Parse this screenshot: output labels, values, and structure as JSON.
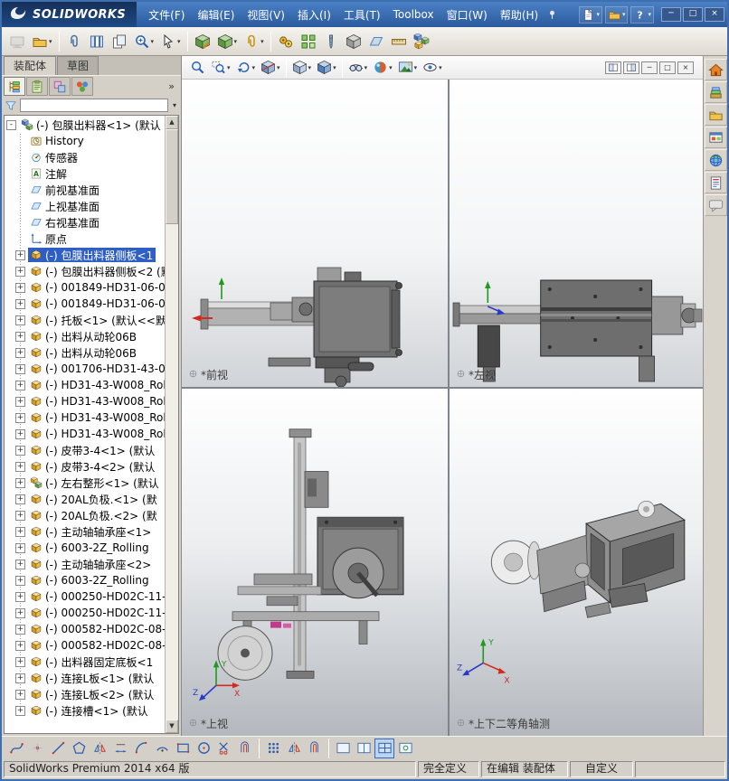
{
  "titlebar": {
    "brand": "SOLIDWORKS",
    "menus": [
      {
        "id": "file",
        "label": "文件(F)"
      },
      {
        "id": "edit",
        "label": "编辑(E)"
      },
      {
        "id": "view",
        "label": "视图(V)"
      },
      {
        "id": "insert",
        "label": "插入(I)"
      },
      {
        "id": "tools",
        "label": "工具(T)"
      },
      {
        "id": "toolbox",
        "label": "Toolbox"
      },
      {
        "id": "window",
        "label": "窗口(W)"
      },
      {
        "id": "help",
        "label": "帮助(H)"
      }
    ],
    "pin_icon": "pin",
    "quick_tools": [
      {
        "name": "new-document",
        "icon": "page",
        "caret": true
      },
      {
        "name": "open-document",
        "icon": "folder",
        "caret": true
      },
      {
        "name": "help",
        "icon": "help",
        "caret": true
      }
    ],
    "window_buttons": [
      {
        "name": "minimize-button",
        "glyph": "─"
      },
      {
        "name": "maximize-button",
        "glyph": "□"
      },
      {
        "name": "close-button",
        "glyph": "×"
      }
    ]
  },
  "main_toolbar": [
    {
      "name": "screen-capture",
      "icon": "screen-gray",
      "disabled": true
    },
    {
      "name": "appearance-folder",
      "icon": "folder",
      "caret": true
    },
    {
      "sep": true
    },
    {
      "name": "attachments",
      "icon": "paperclip"
    },
    {
      "name": "component-columns",
      "icon": "columns"
    },
    {
      "name": "compare-documents",
      "icon": "pages"
    },
    {
      "name": "zoom-tools",
      "icon": "magnifier-plus",
      "caret": true
    },
    {
      "name": "select-tools",
      "icon": "cursor",
      "caret": true
    },
    {
      "sep": true
    },
    {
      "name": "edit-component",
      "icon": "cube-green-pencil"
    },
    {
      "name": "insert-components",
      "icon": "cube-green",
      "caret": true
    },
    {
      "name": "mate",
      "icon": "mate",
      "caret": true
    },
    {
      "sep": true
    },
    {
      "name": "move-component",
      "icon": "gears"
    },
    {
      "name": "linear-component-pattern",
      "icon": "grid-green"
    },
    {
      "name": "smart-fasteners",
      "icon": "fastener"
    },
    {
      "name": "assembly-features",
      "icon": "cube-gray"
    },
    {
      "name": "reference-geometry",
      "icon": "plane"
    },
    {
      "name": "measure",
      "icon": "ruler"
    },
    {
      "name": "exploded-view",
      "icon": "explode"
    }
  ],
  "view_toolbar": [
    {
      "name": "zoom-to-fit",
      "icon": "magnifier"
    },
    {
      "name": "zoom-to-area",
      "icon": "magnifier-rect",
      "caret": true
    },
    {
      "name": "previous-view",
      "icon": "view-prev",
      "caret": true
    },
    {
      "name": "section-view",
      "icon": "section-cube",
      "caret": true
    },
    {
      "sep": true
    },
    {
      "name": "view-orientation",
      "icon": "orient-cube",
      "caret": true
    },
    {
      "name": "display-style",
      "icon": "shaded-cube",
      "caret": true
    },
    {
      "sep": true
    },
    {
      "name": "hide-show-items",
      "icon": "glasses",
      "caret": true
    },
    {
      "name": "edit-appearance",
      "icon": "ball",
      "caret": true
    },
    {
      "name": "apply-scene",
      "icon": "scene",
      "caret": true
    },
    {
      "name": "view-settings",
      "icon": "eye",
      "caret": true
    }
  ],
  "doc_window_buttons": [
    {
      "name": "doc-split-left-button",
      "icon": "win-a"
    },
    {
      "name": "doc-split-right-button",
      "icon": "win-b"
    },
    {
      "name": "doc-minimize-button",
      "glyph": "─"
    },
    {
      "name": "doc-restore-button",
      "glyph": "□"
    },
    {
      "name": "doc-close-button",
      "glyph": "×"
    }
  ],
  "task_pane": [
    {
      "name": "solidworks-resources",
      "icon": "house"
    },
    {
      "name": "design-library",
      "icon": "stack"
    },
    {
      "name": "file-explorer",
      "icon": "folder"
    },
    {
      "name": "view-palette",
      "icon": "palette-window"
    },
    {
      "name": "appearances-scenes",
      "icon": "globe"
    },
    {
      "name": "custom-properties",
      "icon": "form"
    },
    {
      "name": "forum",
      "icon": "chat"
    }
  ],
  "left_panel": {
    "doc_tabs": [
      {
        "id": "assembly",
        "label": "装配体",
        "active": true
      },
      {
        "id": "sketch",
        "label": "草图",
        "active": false
      }
    ],
    "manager_tabs": [
      {
        "name": "featuremanager-tab",
        "icon": "fm-tree",
        "active": true
      },
      {
        "name": "propertymanager-tab",
        "icon": "clipboard",
        "active": false
      },
      {
        "name": "configurationmanager-tab",
        "icon": "config",
        "active": false
      },
      {
        "name": "displaymanager-tab",
        "icon": "balls",
        "active": false
      }
    ],
    "overflow_chevron": "»",
    "filter": {
      "placeholder": ""
    },
    "tree": [
      {
        "icon": "assembly",
        "label": "(-) 包膜出料器<1> (默认",
        "level": 0,
        "expander": "minus"
      },
      {
        "icon": "history",
        "label": "History",
        "level": 1
      },
      {
        "icon": "sensor",
        "label": "传感器",
        "level": 1
      },
      {
        "icon": "annotation",
        "label": "注解",
        "level": 1
      },
      {
        "icon": "plane",
        "label": "前视基准面",
        "level": 1
      },
      {
        "icon": "plane",
        "label": "上视基准面",
        "level": 1
      },
      {
        "icon": "plane",
        "label": "右视基准面",
        "level": 1
      },
      {
        "icon": "origin",
        "label": "原点",
        "level": 1
      },
      {
        "icon": "component",
        "label": "(-) 包膜出料器侧板<1",
        "level": 1,
        "expander": "plus",
        "selected": true
      },
      {
        "icon": "component",
        "label": "(-) 包膜出料器侧板<2 (默",
        "level": 1,
        "expander": "plus"
      },
      {
        "icon": "component",
        "label": "(-) 001849-HD31-06-0",
        "level": 1,
        "expander": "plus"
      },
      {
        "icon": "component",
        "label": "(-) 001849-HD31-06-0",
        "level": 1,
        "expander": "plus"
      },
      {
        "icon": "component",
        "label": "(-) 托板<1> (默认<<默",
        "level": 1,
        "expander": "plus"
      },
      {
        "icon": "component",
        "label": "(-) 出料从动轮06B",
        "level": 1,
        "expander": "plus"
      },
      {
        "icon": "component",
        "label": "(-) 出料从动轮06B",
        "level": 1,
        "expander": "plus"
      },
      {
        "icon": "component",
        "label": "(-) 001706-HD31-43-0",
        "level": 1,
        "expander": "plus"
      },
      {
        "icon": "component",
        "label": "(-) HD31-43-W008_Rol",
        "level": 1,
        "expander": "plus"
      },
      {
        "icon": "component",
        "label": "(-) HD31-43-W008_Rol",
        "level": 1,
        "expander": "plus"
      },
      {
        "icon": "component",
        "label": "(-) HD31-43-W008_Rol",
        "level": 1,
        "expander": "plus"
      },
      {
        "icon": "component",
        "label": "(-) HD31-43-W008_Rol",
        "level": 1,
        "expander": "plus"
      },
      {
        "icon": "component",
        "label": "(-) 皮带3-4<1> (默认",
        "level": 1,
        "expander": "plus"
      },
      {
        "icon": "component",
        "label": "(-) 皮带3-4<2> (默认",
        "level": 1,
        "expander": "plus"
      },
      {
        "icon": "subassembly",
        "label": "(-) 左右整形<1> (默认",
        "level": 1,
        "expander": "plus"
      },
      {
        "icon": "component",
        "label": "(-) 20AL负极.<1> (默",
        "level": 1,
        "expander": "plus"
      },
      {
        "icon": "component",
        "label": "(-) 20AL负极.<2> (默",
        "level": 1,
        "expander": "plus"
      },
      {
        "icon": "component",
        "label": "(-) 主动轴轴承座<1>",
        "level": 1,
        "expander": "plus"
      },
      {
        "icon": "component",
        "label": "(-) 6003-2Z_Rolling",
        "level": 1,
        "expander": "plus"
      },
      {
        "icon": "component",
        "label": "(-) 主动轴轴承座<2>",
        "level": 1,
        "expander": "plus"
      },
      {
        "icon": "component",
        "label": "(-) 6003-2Z_Rolling",
        "level": 1,
        "expander": "plus"
      },
      {
        "icon": "component",
        "label": "(-) 000250-HD02C-11-",
        "level": 1,
        "expander": "plus"
      },
      {
        "icon": "component",
        "label": "(-) 000250-HD02C-11-",
        "level": 1,
        "expander": "plus"
      },
      {
        "icon": "component",
        "label": "(-) 000582-HD02C-08-",
        "level": 1,
        "expander": "plus"
      },
      {
        "icon": "component",
        "label": "(-) 000582-HD02C-08-",
        "level": 1,
        "expander": "plus"
      },
      {
        "icon": "component",
        "label": "(-) 出料器固定底板<1",
        "level": 1,
        "expander": "plus"
      },
      {
        "icon": "component",
        "label": "(-) 连接L板<1> (默认",
        "level": 1,
        "expander": "plus"
      },
      {
        "icon": "component",
        "label": "(-) 连接L板<2> (默认",
        "level": 1,
        "expander": "plus"
      },
      {
        "icon": "component",
        "label": "(-) 连接槽<1> (默认",
        "level": 1,
        "expander": "plus"
      }
    ]
  },
  "viewports": [
    {
      "name": "front-view",
      "label": "*前视"
    },
    {
      "name": "left-view",
      "label": "*左视"
    },
    {
      "name": "top-view",
      "label": "*上视"
    },
    {
      "name": "isometric-view",
      "label": "*上下二等角轴测"
    }
  ],
  "sketch_toolbar": [
    {
      "name": "spline",
      "icon": "sk-spline"
    },
    {
      "name": "point",
      "icon": "sk-point"
    },
    {
      "name": "line",
      "icon": "sk-line"
    },
    {
      "name": "polygon",
      "icon": "sk-polygon"
    },
    {
      "name": "dynamic-mirror",
      "icon": "sk-mirror"
    },
    {
      "name": "smart-dimension",
      "icon": "sk-dim"
    },
    {
      "name": "tangent-arc",
      "icon": "sk-arc"
    },
    {
      "name": "three-point-arc",
      "icon": "sk-arc2"
    },
    {
      "name": "corner-rectangle",
      "icon": "sk-rect"
    },
    {
      "name": "circle",
      "icon": "sk-circle"
    },
    {
      "name": "trim-entities",
      "icon": "sk-trim"
    },
    {
      "name": "offset-entities",
      "icon": "sk-offset"
    },
    {
      "sep": true
    },
    {
      "name": "linear-sketch-pattern",
      "icon": "sk-pattern"
    },
    {
      "name": "mirror-entities",
      "icon": "sk-mirror"
    },
    {
      "name": "convert-entities",
      "icon": "sk-offset"
    },
    {
      "sep": true
    },
    {
      "name": "single-view",
      "icon": "vp-single"
    },
    {
      "name": "two-view",
      "icon": "vp-two"
    },
    {
      "name": "four-view",
      "icon": "vp-four",
      "active": true
    },
    {
      "name": "link-views",
      "icon": "vp-link"
    }
  ],
  "status_bar": {
    "product": "SolidWorks Premium 2014 x64 版",
    "definition_status": "完全定义",
    "edit_status": "在编辑 装配体",
    "customize": "自定义"
  },
  "colors": {
    "titlebar_blue": "#2c5a9e",
    "selection_blue": "#2f5fc4",
    "chrome_gray": "#d4d0c8",
    "viewport_gradient_bottom": "#b4b8be"
  }
}
